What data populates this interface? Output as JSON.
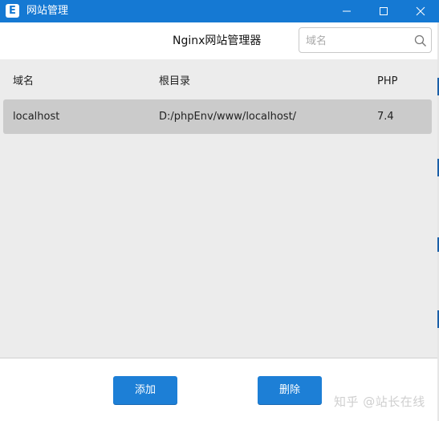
{
  "window": {
    "title": "网站管理",
    "app_icon_letter": "E",
    "controls": [
      "minimize-icon",
      "maximize-icon",
      "close-icon"
    ]
  },
  "header": {
    "heading": "Nginx网站管理器",
    "search": {
      "placeholder": "域名",
      "value": "",
      "icon": "search-icon"
    }
  },
  "table": {
    "columns": [
      "域名",
      "根目录",
      "PHP"
    ],
    "rows": [
      {
        "domain": "localhost",
        "root": "D:/phpEnv/www/localhost/",
        "php": "7.4",
        "selected": true
      }
    ]
  },
  "footer": {
    "add_label": "添加",
    "delete_label": "删除"
  },
  "watermark": "知乎 @站长在线",
  "colors": {
    "titlebar": "#1579d3",
    "button": "#1d7fd6",
    "list_bg": "#ececec",
    "row_selected": "#cbcbcb"
  }
}
